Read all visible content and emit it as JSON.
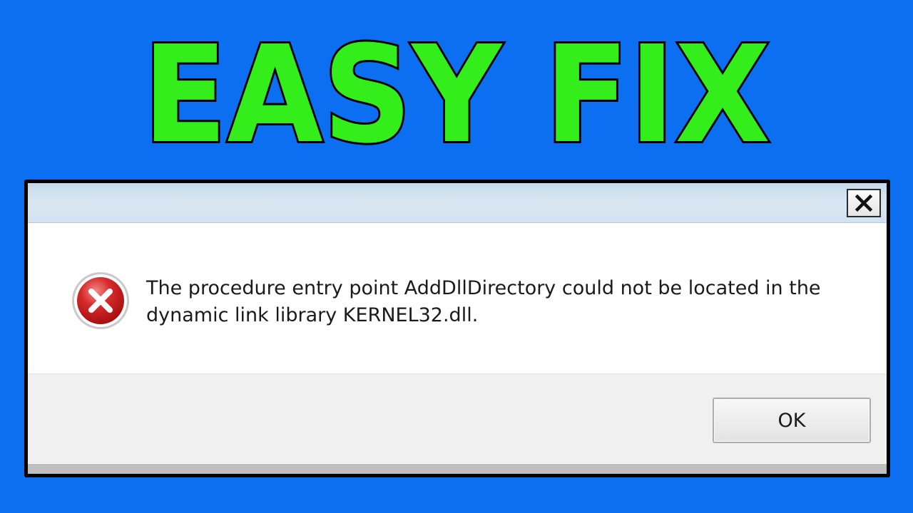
{
  "headline": {
    "text": "EASY FIX",
    "fill_color": "#33ee1a",
    "outline_color": "#000000"
  },
  "background_color": "#0c6ff2",
  "dialog": {
    "close_icon": "close-icon",
    "error_icon": "error-icon",
    "message_line1": "The procedure entry point AddDllDirectory could not be located in the",
    "message_line2": "dynamic link library KERNEL32.dll.",
    "ok_label": "OK"
  }
}
